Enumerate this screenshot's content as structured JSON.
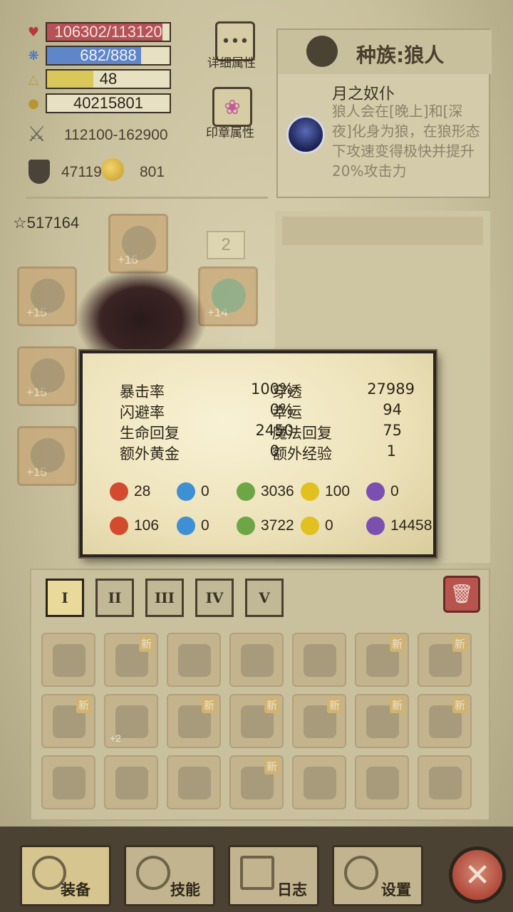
{
  "stats": {
    "hp": {
      "text": "106302/113120",
      "current": 106302,
      "max": 113120,
      "color": "#b65257",
      "icon": "heart-icon"
    },
    "mp": {
      "text": "682/888",
      "current": 682,
      "max": 888,
      "color": "#5e86c8",
      "icon": "mana-icon"
    },
    "level": {
      "text": "48",
      "progress_fraction": 0.38,
      "color": "#d9c75a",
      "icon": "level-triangle-icon"
    },
    "gold": {
      "text": "40215801",
      "icon": "gold-icon"
    },
    "attack": {
      "text": "112100-162900",
      "icon": "crossed-swords-icon"
    },
    "defense": {
      "text": "47119",
      "icon": "shield-icon"
    },
    "magic": {
      "text": "801",
      "icon": "magic-orb-icon"
    }
  },
  "buttons": {
    "detail_label": "详细属性",
    "seal_label": "印章属性"
  },
  "race": {
    "title": "种族:狼人",
    "skill_name": "月之奴仆",
    "skill_desc": "狼人会在[晚上]和[深夜]化身为狼，在狼形态下攻速变得极快并提升20%攻击力"
  },
  "character": {
    "power": "517164",
    "badge": "2",
    "slots": [
      "+15",
      "+15",
      "+15",
      "+15",
      "+14"
    ]
  },
  "tooltip": {
    "rows": [
      {
        "l1": "暴击率",
        "v1": "100%",
        "l2": "穿透",
        "v2": "27989"
      },
      {
        "l1": "闪避率",
        "v1": "0%",
        "l2": "幸运",
        "v2": "94"
      },
      {
        "l1": "生命回复",
        "v1": "2450",
        "l2": "魔法回复",
        "v2": "75"
      },
      {
        "l1": "额外黄金",
        "v1": "0",
        "l2": "额外经验",
        "v2": "1"
      }
    ],
    "elements_attack": [
      "28",
      "0",
      "3036",
      "100",
      "0"
    ],
    "elements_resist": [
      "106",
      "0",
      "3722",
      "0",
      "14458"
    ],
    "element_colors": [
      "#d44a2e",
      "#3f8fd4",
      "#6ea646",
      "#e2c020",
      "#7a4fb0"
    ]
  },
  "inventory": {
    "tabs": [
      "I",
      "II",
      "III",
      "IV",
      "V"
    ],
    "new_label": "新",
    "plus_label": "+2"
  },
  "nav": {
    "equip": "装备",
    "skill": "技能",
    "log": "日志",
    "settings": "设置"
  }
}
